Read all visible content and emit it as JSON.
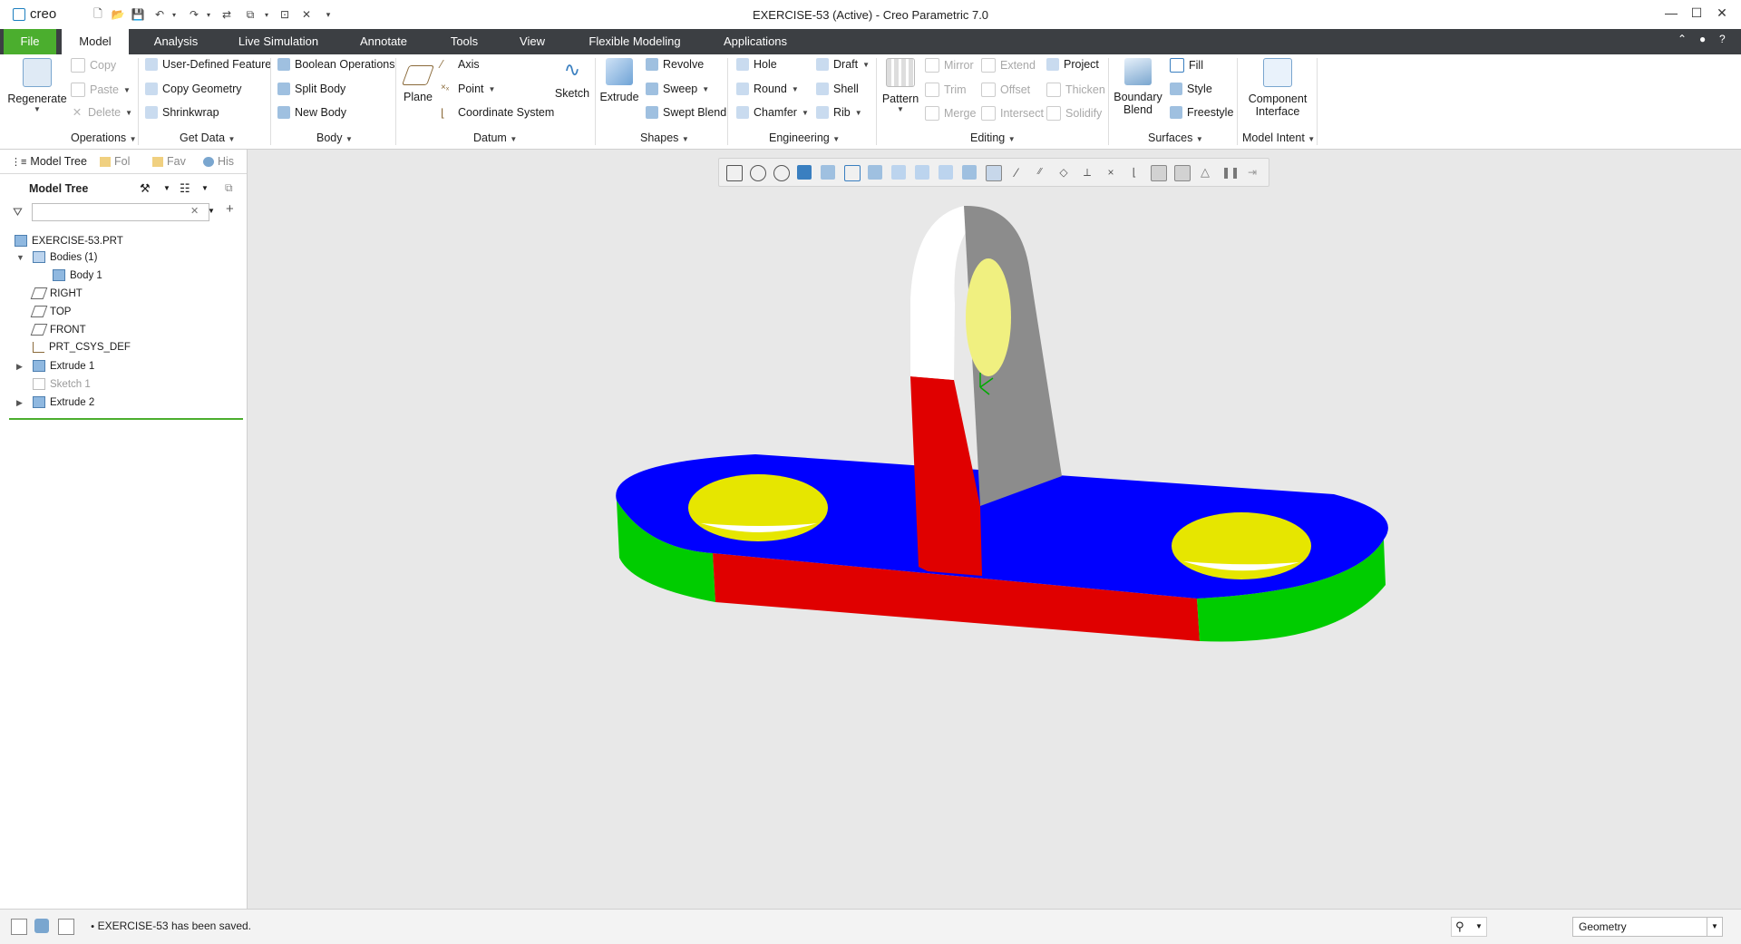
{
  "app": {
    "logo_text": "creo",
    "window_title": "EXERCISE-53 (Active) - Creo Parametric 7.0"
  },
  "window_controls": {
    "minimize": "—",
    "maximize": "☐",
    "close": "✕"
  },
  "tabs": {
    "file": "File",
    "model": "Model",
    "analysis": "Analysis",
    "live_simulation": "Live Simulation",
    "annotate": "Annotate",
    "tools": "Tools",
    "view": "View",
    "flexible_modeling": "Flexible Modeling",
    "applications": "Applications"
  },
  "ribbon": {
    "operations": {
      "regenerate": "Regenerate",
      "copy": "Copy",
      "paste": "Paste",
      "delete": "Delete",
      "group": "Operations"
    },
    "get_data": {
      "udf": "User-Defined Feature",
      "copy_geometry": "Copy Geometry",
      "shrinkwrap": "Shrinkwrap",
      "group": "Get Data"
    },
    "body": {
      "boolean": "Boolean Operations",
      "split": "Split Body",
      "new": "New Body",
      "group": "Body"
    },
    "datum": {
      "plane": "Plane",
      "axis": "Axis",
      "point": "Point",
      "csys": "Coordinate System",
      "sketch": "Sketch",
      "group": "Datum"
    },
    "shapes": {
      "extrude": "Extrude",
      "revolve": "Revolve",
      "sweep": "Sweep",
      "swept_blend": "Swept Blend",
      "group": "Shapes"
    },
    "engineering": {
      "hole": "Hole",
      "round": "Round",
      "chamfer": "Chamfer",
      "draft": "Draft",
      "shell": "Shell",
      "rib": "Rib",
      "group": "Engineering"
    },
    "editing": {
      "pattern": "Pattern",
      "mirror": "Mirror",
      "trim": "Trim",
      "merge": "Merge",
      "extend": "Extend",
      "offset": "Offset",
      "intersect": "Intersect",
      "project": "Project",
      "thicken": "Thicken",
      "solidify": "Solidify",
      "group": "Editing"
    },
    "surfaces": {
      "boundary_blend_1": "Boundary",
      "boundary_blend_2": "Blend",
      "fill": "Fill",
      "style": "Style",
      "freestyle": "Freestyle",
      "group": "Surfaces"
    },
    "model_intent": {
      "component_1": "Component",
      "component_2": "Interface",
      "group": "Model Intent"
    }
  },
  "panel": {
    "tabs": {
      "model_tree": "Model Tree",
      "folder": "Fol",
      "favorites": "Fav",
      "history": "His"
    },
    "header": "Model Tree",
    "search_placeholder": "",
    "tree": [
      {
        "label": "EXERCISE-53.PRT"
      },
      {
        "label": "Bodies (1)"
      },
      {
        "label": "Body 1"
      },
      {
        "label": "RIGHT"
      },
      {
        "label": "TOP"
      },
      {
        "label": "FRONT"
      },
      {
        "label": "PRT_CSYS_DEF"
      },
      {
        "label": "Extrude 1"
      },
      {
        "label": "Sketch 1"
      },
      {
        "label": "Extrude 2"
      }
    ]
  },
  "status": {
    "message": "EXERCISE-53 has been saved.",
    "filter_value": "Geometry"
  },
  "colors": {
    "accent_green": "#4bae2e",
    "tab_bar": "#3c3f43",
    "viewport_bg": "#e8e8e8",
    "face_blue": "#0000ff",
    "face_red": "#e00000",
    "face_green": "#00cc00",
    "face_yellow": "#e6e600",
    "face_gray": "#8c8c8c"
  }
}
